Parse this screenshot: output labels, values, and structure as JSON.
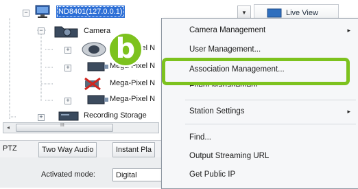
{
  "tree": {
    "server_label": "ND8401(127.0.0.1)",
    "camera_group_label": "Camera",
    "items": [
      {
        "label": "Mega-Pixel N",
        "icon": "ptz-camera-icon"
      },
      {
        "label": "Mega-Pixel N",
        "icon": "box-camera-icon"
      },
      {
        "label": "Mega-Pixel N",
        "icon": "disconnected-camera-icon"
      },
      {
        "label": "Mega-Pixel N",
        "icon": "box-camera-icon"
      }
    ],
    "recording_label": "Recording Storage"
  },
  "toolbar": {
    "live_view_label": "Live View",
    "dropdown_glyph": "▼"
  },
  "scrollbar": {
    "thumb_glyph": "III"
  },
  "tabs": [
    {
      "label": "PTZ"
    },
    {
      "label": "Two Way Audio"
    },
    {
      "label": "Instant Pla"
    }
  ],
  "activated_mode": {
    "label": "Activated mode:",
    "value": "Digital"
  },
  "context_menu": {
    "items": [
      {
        "label": "Camera Management",
        "submenu": true
      },
      {
        "label": "User Management..."
      },
      {
        "label": "Association Management...",
        "highlighted": true
      },
      {
        "label": "Event Management..."
      },
      {
        "label": "Station Settings",
        "submenu": true
      },
      {
        "label": "Find..."
      },
      {
        "label": "Output Streaming URL"
      },
      {
        "label": "Get Public IP"
      }
    ],
    "submenu_glyph": "▸"
  },
  "annotation": {
    "step_letter": "b",
    "highlight_color": "#7dc21e"
  },
  "colors": {
    "selection": "#2d6fd6",
    "accent": "#7dc21e"
  }
}
